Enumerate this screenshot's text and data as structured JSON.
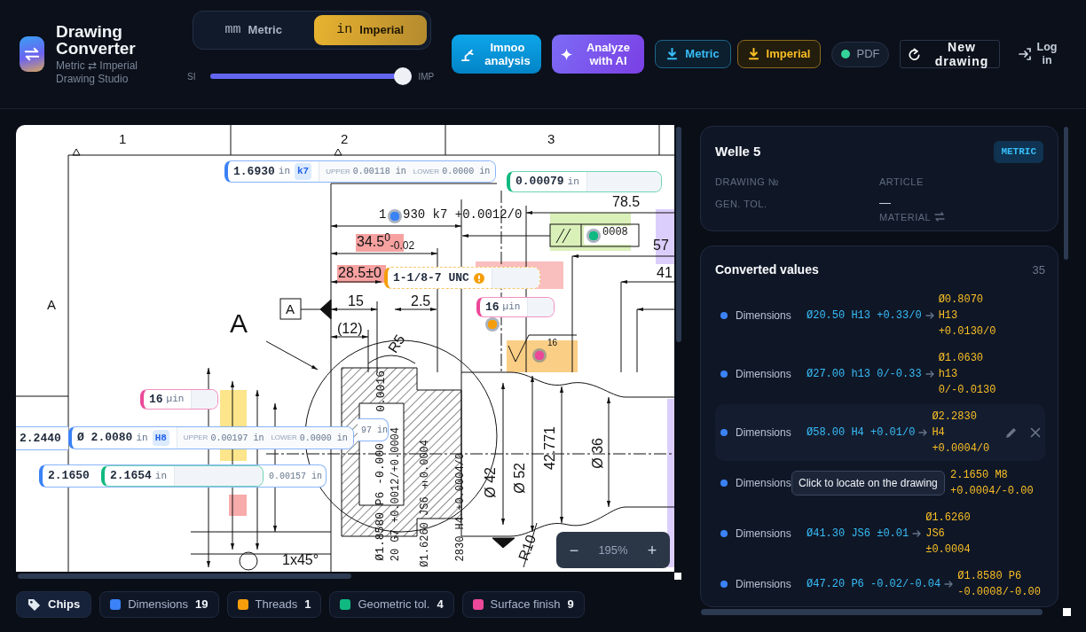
{
  "app": {
    "title": "Drawing Converter",
    "subtitle": "Metric ⇄ Imperial Drawing Studio"
  },
  "unit_toggle": [
    {
      "symbol": "mm",
      "label": "Metric",
      "selected": false
    },
    {
      "symbol": "in",
      "label": "Imperial",
      "selected": true
    }
  ],
  "unit_slider": {
    "min_label": "SI",
    "max_label": "IMP",
    "level": 1
  },
  "analysis_buttons": [
    {
      "kind": "imnoo",
      "label": "Imnoo analysis"
    },
    {
      "kind": "ai",
      "label": "Analyze with AI"
    }
  ],
  "downloads": [
    {
      "kind": "metric",
      "label": "Metric"
    },
    {
      "kind": "imperial",
      "label": "Imperial"
    }
  ],
  "file_badge": {
    "label": "PDF",
    "loaded": true
  },
  "new_drawing_button": {
    "label": "New drawing"
  },
  "login_button": {
    "label": "Log in"
  },
  "drawing": {
    "labels": [
      "1",
      "2",
      "3",
      "A",
      "1",
      "930 k7 +0.0012/0",
      "78.5",
      "57",
      "34.5$^{0}$$_{-0.02}$",
      "28.5±0",
      "15",
      "2.5",
      "(12)",
      "A",
      "A",
      "R5",
      "0008",
      "41",
      "16",
      "Ø 42",
      "Ø 52",
      "42.771",
      "Ø 36",
      "R10",
      "1x45°",
      "Ø1.8580 P6 -0.000",
      "20 G7 +0.0012/+0.0004",
      "Ø1.6260 JS6 ±0.0004",
      "2830 H4 +0.0004/0",
      "0.0016"
    ],
    "markers": [
      {
        "kind": "dimension"
      },
      {
        "kind": "geometric"
      },
      {
        "kind": "thread"
      },
      {
        "kind": "surface"
      }
    ],
    "chips": [
      {
        "kind": "dimension",
        "value": "1.6930",
        "unit": "in",
        "fit": "k7",
        "upper_label": "UPPER",
        "upper": "0.00118 in",
        "lower_label": "LOWER",
        "lower": "0.0000 in",
        "warning": false
      },
      {
        "kind": "geometric",
        "value": "0.00079",
        "unit": "in",
        "warning": false
      },
      {
        "kind": "thread",
        "value": "1-1/8-7 UNC",
        "warning": true
      },
      {
        "kind": "surface",
        "value": "16",
        "unit": "µin",
        "warning": false
      },
      {
        "kind": "surface",
        "value": "16",
        "unit": "µin",
        "warning": false
      },
      {
        "kind": "dimension",
        "tail": "97 in",
        "warning": false
      },
      {
        "kind": "dimension",
        "value": "2.2440",
        "warning": false
      },
      {
        "kind": "dimension",
        "value": "Ø 2.0080",
        "unit": "in",
        "fit": "H8",
        "upper_label": "UPPER",
        "upper": "0.00197 in",
        "lower_label": "LOWER",
        "lower": "0.0000 in",
        "warning": false
      },
      {
        "kind": "dimension",
        "value": "2.1650",
        "tail": "0.00157 in",
        "warning": false
      },
      {
        "kind": "geometric",
        "value": "2.1654",
        "unit": "in",
        "warning": false
      }
    ],
    "zoom": {
      "out": "−",
      "value": "195%",
      "in": "+"
    }
  },
  "chip_toggle": {
    "label": "Chips"
  },
  "legend": [
    {
      "kind": "dimension",
      "label": "Dimensions",
      "count": "19",
      "color": "#3b82f6"
    },
    {
      "kind": "thread",
      "label": "Threads",
      "count": "1",
      "color": "#f59e0b"
    },
    {
      "kind": "geometric",
      "label": "Geometric tol.",
      "count": "4",
      "color": "#10b981"
    },
    {
      "kind": "surface",
      "label": "Surface finish",
      "count": "9",
      "color": "#ec4899"
    }
  ],
  "details_card": {
    "title": "Welle 5",
    "unit_badge": "METRIC",
    "columns": [
      [
        {
          "label": "DRAWING №"
        },
        {
          "label": "GEN. TOL."
        }
      ],
      [
        {
          "label": "ARTICLE",
          "value": "—"
        },
        {
          "label": "MATERIAL",
          "swappable": true
        }
      ]
    ]
  },
  "converted_card": {
    "title": "Converted values",
    "count": "35",
    "rows": [
      {
        "kind": "dimension",
        "category": "Dimensions",
        "original": "Ø20.50 H13 +0.33/0",
        "converted": "Ø0.8070 H13 +0.0130/0",
        "hovered": false
      },
      {
        "kind": "dimension",
        "category": "Dimensions",
        "original": "Ø27.00 h13 0/-0.33",
        "converted": "Ø1.0630 h13 0/-0.0130",
        "hovered": false
      },
      {
        "kind": "dimension",
        "category": "Dimensions",
        "original": "Ø58.00 H4 +0.01/0",
        "converted": "Ø2.2830 H4 +0.0004/0",
        "hovered": true
      },
      {
        "kind": "dimension",
        "category": "Dimensions",
        "converted": "2.1650 M8 +0.0004/-0.00",
        "hovered": false,
        "tooltip": "Click to locate on the drawing"
      },
      {
        "kind": "dimension",
        "category": "Dimensions",
        "original": "Ø41.30 JS6 ±0.01",
        "converted": "Ø1.6260 JS6 ±0.0004",
        "hovered": false
      },
      {
        "kind": "dimension",
        "category": "Dimensions",
        "original": "Ø47.20 P6 -0.02/-0.04",
        "converted": "Ø1.8580 P6 -0.0008/-0.00",
        "hovered": false
      }
    ]
  }
}
